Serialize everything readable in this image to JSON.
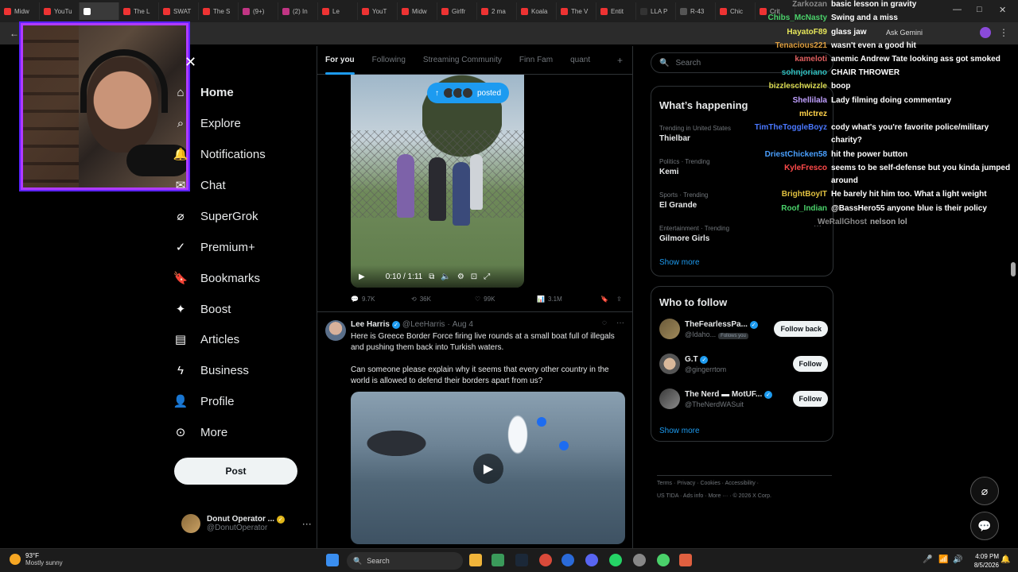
{
  "browser": {
    "tabs": [
      "Midw",
      "YouTu",
      "",
      "The L",
      "SWAT",
      "The S",
      "(9+)",
      "(2) In",
      "Le",
      "YouT",
      "Midw",
      "Girlfr",
      "2 ma",
      "Koala",
      "The V",
      "Entit",
      "LLA P",
      "R-43",
      "Chic",
      "Crit"
    ],
    "ask_gemini": "Ask Gemini"
  },
  "sidebar": {
    "items": [
      {
        "label": "Home",
        "icon": "home-icon"
      },
      {
        "label": "Explore",
        "icon": "search-icon"
      },
      {
        "label": "Notifications",
        "icon": "bell-icon"
      },
      {
        "label": "Chat",
        "icon": "chat-icon"
      },
      {
        "label": "SuperGrok",
        "icon": "grok-icon"
      },
      {
        "label": "Premium+",
        "icon": "premium-icon"
      },
      {
        "label": "Bookmarks",
        "icon": "bookmark-icon"
      },
      {
        "label": "Boost",
        "icon": "boost-icon"
      },
      {
        "label": "Articles",
        "icon": "articles-icon"
      },
      {
        "label": "Business",
        "icon": "lightning-icon"
      },
      {
        "label": "Profile",
        "icon": "person-icon"
      },
      {
        "label": "More",
        "icon": "more-icon"
      }
    ],
    "post_label": "Post",
    "account": {
      "name": "Donut Operator ...",
      "handle": "@DonutOperator"
    }
  },
  "feed": {
    "tabs": [
      "For you",
      "Following",
      "Streaming Community",
      "Finn Fam",
      "quant"
    ],
    "posted_pill": "posted",
    "video1": {
      "time": "0:10 / 1:11"
    },
    "tweet1_actions": {
      "replies": "9.7K",
      "reposts": "36K",
      "likes": "99K",
      "views": "3.1M"
    },
    "tweet2": {
      "name": "Lee Harris",
      "handle": "@LeeHarris",
      "date": "Aug 4",
      "text1": "Here is Greece Border Force firing live rounds at a small boat full of illegals and pushing them back into Turkish waters.",
      "text2": "Can someone please explain why it seems that every other country in the world is allowed to defend their borders apart from us?"
    }
  },
  "right": {
    "search_placeholder": "Search",
    "happening": {
      "title": "What’s happening",
      "trends": [
        {
          "ctx": "Trending in United States",
          "title": "Thielbar"
        },
        {
          "ctx": "Politics · Trending",
          "title": "Kemi"
        },
        {
          "ctx": "Sports · Trending",
          "title": "El Grande"
        },
        {
          "ctx": "Entertainment · Trending",
          "title": "Gilmore Girls"
        }
      ],
      "show_more": "Show more"
    },
    "who_to_follow": {
      "title": "Who to follow",
      "items": [
        {
          "name": "TheFearlessPa...",
          "handle": "@Idaho...",
          "badge": "Follows you",
          "button": "Follow back"
        },
        {
          "name": "G.T",
          "handle": "@gingerrtom",
          "badge": "",
          "button": "Follow"
        },
        {
          "name": "The Nerd ▬ MotUF...",
          "handle": "@TheNerdWASuit",
          "badge": "",
          "button": "Follow"
        }
      ],
      "show_more": "Show more"
    },
    "footer_line1": "Terms · Privacy · Cookies · Accessibility ·",
    "footer_line2": "US TIDA · Ads info · More ··· · © 2026 X Corp."
  },
  "chat": [
    {
      "user": "Zarkozan",
      "msg": "basic lesson in gravity",
      "color": "#8a8a8a"
    },
    {
      "user": "Chibs_McNasty",
      "msg": "Swing and a miss",
      "color": "#4ad16a"
    },
    {
      "user": "HayatoF89",
      "msg": "glass jaw",
      "color": "#e6e65a"
    },
    {
      "user": "Tenacious221",
      "msg": "wasn't even a good hit",
      "color": "#e0a040"
    },
    {
      "user": "kameloti",
      "msg": "anemic Andrew Tate looking ass got smoked",
      "color": "#e06060"
    },
    {
      "user": "sohnjoriano",
      "msg": "CHAIR THROWER",
      "color": "#2fc0c0"
    },
    {
      "user": "bizzleschwizzle",
      "msg": "boop",
      "color": "#d9d950"
    },
    {
      "user": "Shellilala",
      "msg": "Lady filming doing commentary",
      "color": "#c0a0ff"
    },
    {
      "user": "mlctrez",
      "msg": "",
      "color": "#ffd24a"
    },
    {
      "user": "TimTheToggleBoyz",
      "msg": "cody what's you're favorite police/military",
      "msg2": "charity?",
      "color": "#4a78ff"
    },
    {
      "user": "DriestChicken58",
      "msg": "hit the power button",
      "color": "#4aa0ff"
    },
    {
      "user": "KyleFresco",
      "msg": "seems to be self-defense but you kinda jumped",
      "msg2": "around",
      "color": "#ff4a4a"
    },
    {
      "user": "BrightBoyIT",
      "msg": "He barely hit him too. What a light weight",
      "color": "#e0c040"
    },
    {
      "user": "Roof_Indian",
      "msg": "@BassHero55 anyone blue is their policy",
      "color": "#4ad16a"
    },
    {
      "user": "WeRallGhost",
      "msg": "nelson lol",
      "color": "#8a8a8a"
    }
  ],
  "taskbar": {
    "temp": "93°F",
    "condition": "Mostly sunny",
    "search": "Search",
    "time": "4:09 PM",
    "date": "8/5/2026"
  }
}
